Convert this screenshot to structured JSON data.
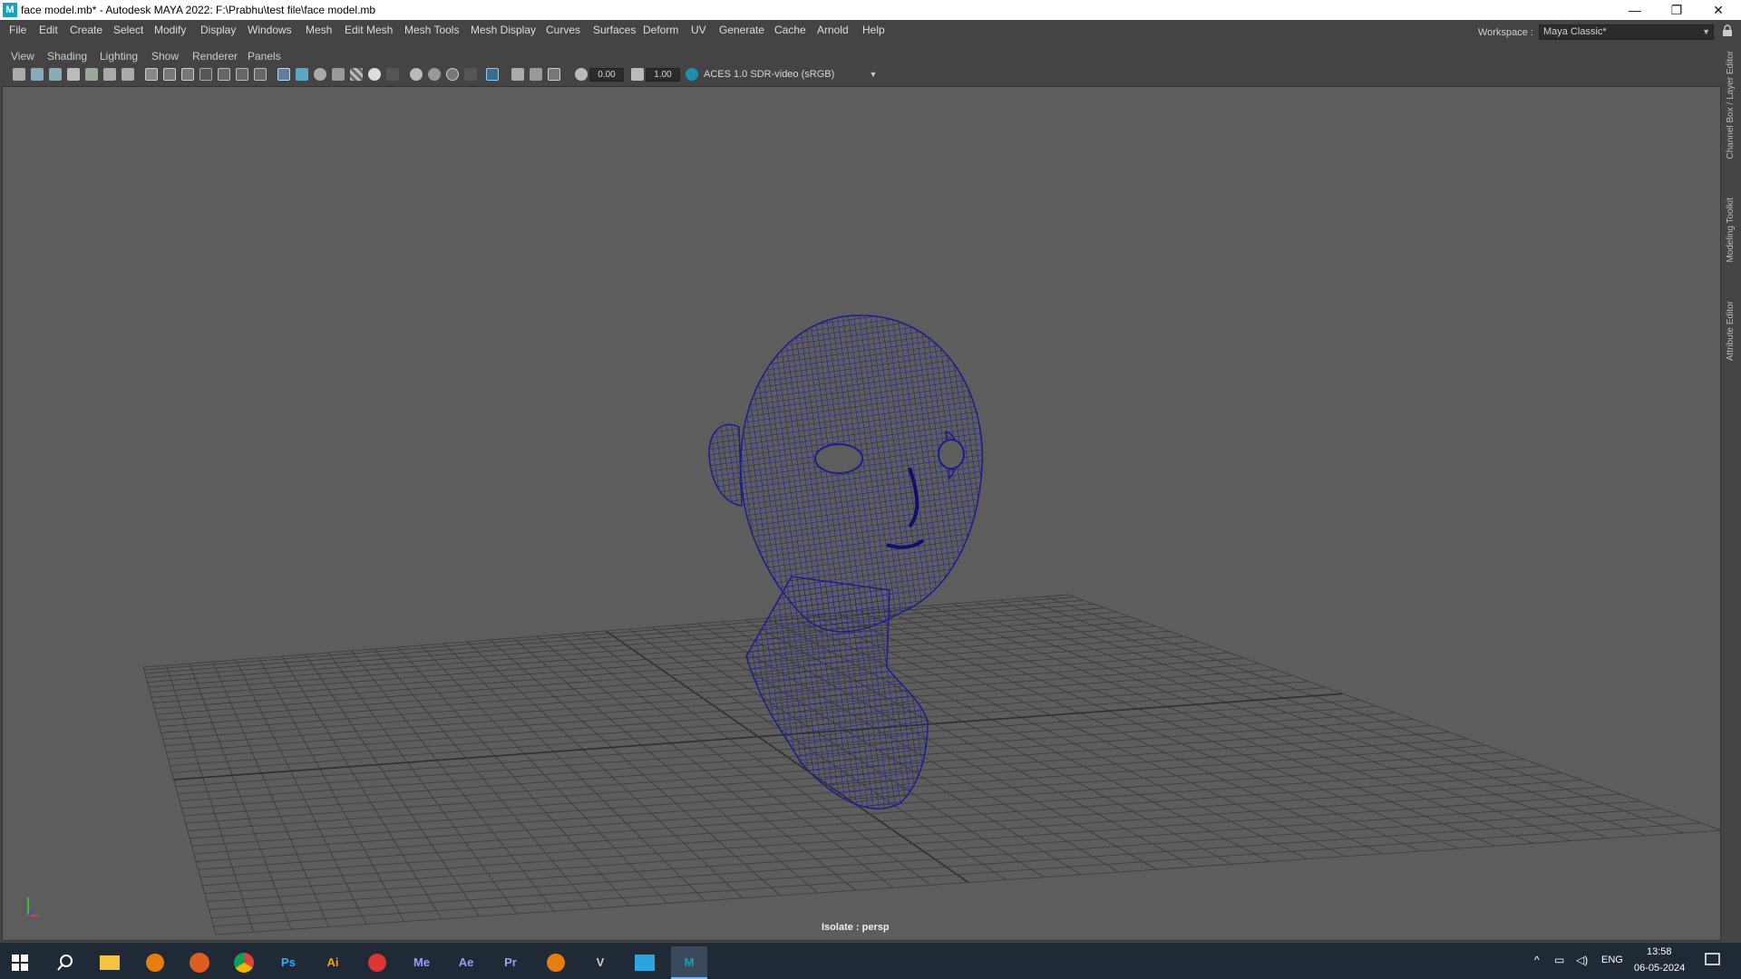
{
  "window": {
    "title": "face model.mb* - Autodesk MAYA 2022: F:\\Prabhu\\test file\\face model.mb",
    "app_icon": "M",
    "minimize": "—",
    "restore": "❐",
    "close": "✕"
  },
  "menubar": {
    "items": [
      "File",
      "Edit",
      "Create",
      "Select",
      "Modify",
      "Display",
      "Windows",
      "Mesh",
      "Edit Mesh",
      "Mesh Tools",
      "Mesh Display",
      "Curves",
      "Surfaces",
      "Deform",
      "UV",
      "Generate",
      "Cache",
      "Arnold",
      "Help"
    ],
    "workspace_label": "Workspace :",
    "workspace_value": "Maya Classic*"
  },
  "panel_menu": {
    "items": [
      "View",
      "Shading",
      "Lighting",
      "Show",
      "Renderer",
      "Panels"
    ]
  },
  "toolbar": {
    "exposure_value": "0.00",
    "gamma_value": "1.00",
    "colorspace": "ACES 1.0 SDR-video (sRGB)"
  },
  "viewport": {
    "isolate_label": "Isolate : persp",
    "mesh_color": "#1d1d8c",
    "grid_color": "#3e3e3e",
    "bg_color": "#5d5d5d"
  },
  "sidebar": {
    "tabs": [
      "Channel Box / Layer Editor",
      "Modeling Toolkit",
      "Attribute Editor"
    ]
  },
  "taskbar": {
    "apps": [
      "start-icon",
      "search-icon",
      "file-explorer-icon",
      "blender-icon",
      "firefox-icon",
      "chrome-icon",
      "Ps",
      "Ai",
      "substance-icon",
      "Me",
      "Ae",
      "Pr",
      "blender-icon",
      "vectorworks-icon",
      "paint-icon",
      "M"
    ],
    "tray_lang": "ENG",
    "time": "13:58",
    "date": "06-05-2024"
  }
}
